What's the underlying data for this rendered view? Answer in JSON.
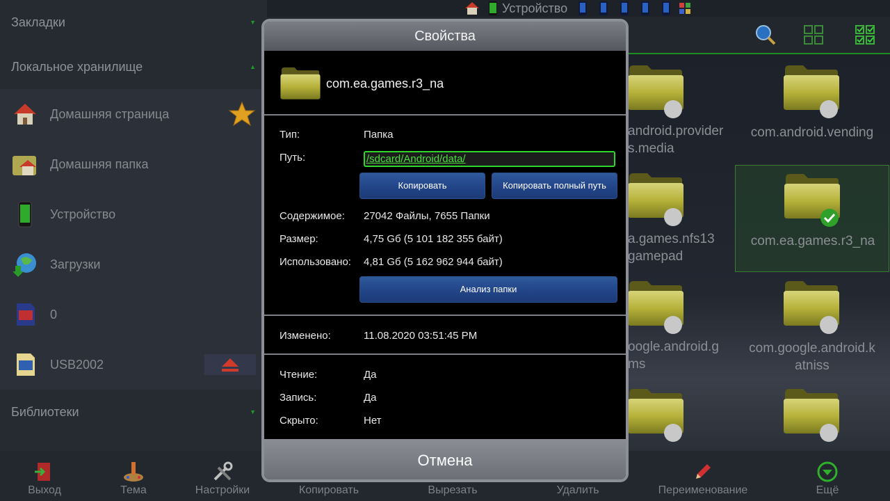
{
  "sidebar": {
    "bookmarks": "Закладки",
    "local_storage": "Локальное хранилище",
    "items": [
      {
        "label": "Домашняя страница",
        "icon": "home-icon"
      },
      {
        "label": "Домашняя папка",
        "icon": "home-folder-icon"
      },
      {
        "label": "Устройство",
        "icon": "phone-icon"
      },
      {
        "label": "Загрузки",
        "icon": "download-globe-icon"
      },
      {
        "label": "0",
        "icon": "sd-card-icon"
      },
      {
        "label": "USB2002",
        "icon": "sd-card-icon"
      }
    ],
    "libraries": "Библиотеки"
  },
  "statusbar": {
    "title": "Устройство"
  },
  "grid": {
    "tiles": [
      {
        "label": "android.provider\ns.media"
      },
      {
        "label": "com.android.vending"
      },
      {
        "label": "a.games.nfs13\ngamepad"
      },
      {
        "label": "com.ea.games.r3_na"
      },
      {
        "label": "oogle.android.g\nms"
      },
      {
        "label": "com.google.android.k\natniss"
      }
    ]
  },
  "bottombar": {
    "items": [
      {
        "label": "Выход"
      },
      {
        "label": "Тема"
      },
      {
        "label": "Настройки"
      },
      {
        "label": "Копировать"
      },
      {
        "label": "Вырезать"
      },
      {
        "label": "Удалить"
      },
      {
        "label": "Переименование"
      },
      {
        "label": "Ещё"
      }
    ]
  },
  "dialog": {
    "title": "Свойства",
    "folder_name": "com.ea.games.r3_na",
    "type_label": "Тип:",
    "type_value": "Папка",
    "path_label": "Путь:",
    "path_value": "/sdcard/Android/data/",
    "copy_button": "Копировать",
    "copy_full_path_button": "Копировать полный путь",
    "contents_label": "Содержимое:",
    "contents_value": "27042 Файлы, 7655 Папки",
    "size_label": "Размер:",
    "size_value": "4,75 Gб (5 101 182 355 байт)",
    "used_label": "Использовано:",
    "used_value": "4,81 Gб (5 162 962 944 байт)",
    "analyze_button": "Анализ папки",
    "modified_label": "Изменено:",
    "modified_value": "11.08.2020 03:51:45 PM",
    "read_label": "Чтение:",
    "read_value": "Да",
    "write_label": "Запись:",
    "write_value": "Да",
    "hidden_label": "Скрыто:",
    "hidden_value": "Нет",
    "cancel_button": "Отмена"
  },
  "colors": {
    "accent_green": "#2fd72c",
    "button_blue": "#23468a",
    "folder_yellow": "#b9b43a"
  }
}
